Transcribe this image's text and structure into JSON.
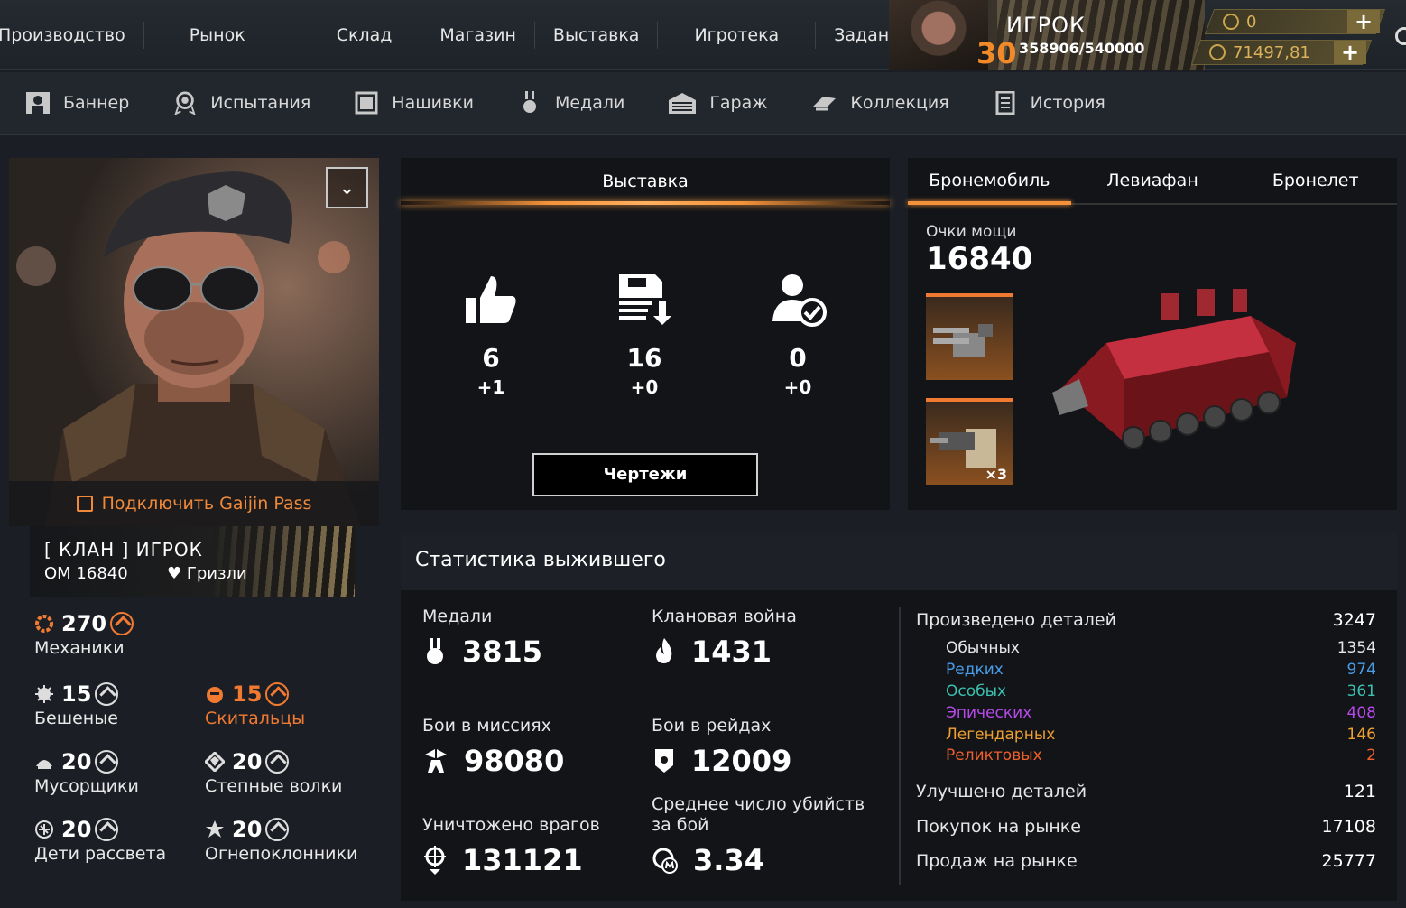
{
  "topnav": {
    "items": [
      "Производство",
      "Рынок",
      "Склад",
      "Магазин",
      "Выставка",
      "Игротека",
      "Задания"
    ]
  },
  "player": {
    "name": "ИГРОК",
    "level": "30",
    "xp": "358906/540000",
    "currency_1": "0",
    "currency_2": "71497,81"
  },
  "subnav": {
    "items": [
      {
        "label": "Баннер",
        "icon": "banner-icon"
      },
      {
        "label": "Испытания",
        "icon": "trials-icon"
      },
      {
        "label": "Нашивки",
        "icon": "patches-icon"
      },
      {
        "label": "Медали",
        "icon": "medals-icon"
      },
      {
        "label": "Гараж",
        "icon": "garage-icon"
      },
      {
        "label": "Коллекция",
        "icon": "collection-icon"
      },
      {
        "label": "История",
        "icon": "history-icon"
      }
    ]
  },
  "profile": {
    "gaijin_link": "Подключить Gaijin Pass",
    "clan_name": "[ КЛАН ]  ИГРОК",
    "om": "ОМ 16840",
    "faction_label": "Гризли",
    "factions": {
      "main": {
        "value": "270",
        "label": "Механики"
      },
      "list": [
        {
          "value": "15",
          "label": "Бешеные",
          "color": "#e8e8e8"
        },
        {
          "value": "15",
          "label": "Скитальцы",
          "color": "#f07a32"
        },
        {
          "value": "20",
          "label": "Мусорщики",
          "color": "#e8e8e8"
        },
        {
          "value": "20",
          "label": "Степные волки",
          "color": "#e8e8e8"
        },
        {
          "value": "20",
          "label": "Дети рассвета",
          "color": "#e8e8e8"
        },
        {
          "value": "20",
          "label": "Огнепоклонники",
          "color": "#e8e8e8"
        }
      ]
    }
  },
  "exhibition": {
    "title": "Выставка",
    "stats": [
      {
        "icon": "thumbs-up-icon",
        "value": "6",
        "delta": "+1"
      },
      {
        "icon": "download-icon",
        "value": "16",
        "delta": "+0"
      },
      {
        "icon": "subscriber-icon",
        "value": "0",
        "delta": "+0"
      }
    ],
    "button": "Чертежи"
  },
  "vehicle": {
    "tabs": [
      "Бронемобиль",
      "Левиафан",
      "Бронелет"
    ],
    "power_label": "Очки мощи",
    "power_value": "16840",
    "parts": [
      {
        "mult": ""
      },
      {
        "mult": "×3"
      }
    ]
  },
  "stats": {
    "title": "Статистика выжившего",
    "blocks": [
      {
        "label": "Медали",
        "value": "3815",
        "icon": "medal-icon"
      },
      {
        "label": "Клановая война",
        "value": "1431",
        "icon": "flame-icon"
      },
      {
        "label": "Бои в миссиях",
        "value": "98080",
        "icon": "missions-icon"
      },
      {
        "label": "Бои в рейдах",
        "value": "12009",
        "icon": "raid-icon"
      },
      {
        "label": "Уничтожено врагов",
        "value": "131121",
        "icon": "crosshair-icon"
      },
      {
        "label": "Среднее число убийств за бой",
        "value": "3.34",
        "icon": "avg-kills-icon"
      }
    ],
    "produced": {
      "label": "Произведено деталей",
      "value": "3247"
    },
    "rarities": [
      {
        "label": "Обычных",
        "value": "1354",
        "color": "#e6e6e6"
      },
      {
        "label": "Редких",
        "value": "974",
        "color": "#4a9ce8"
      },
      {
        "label": "Особых",
        "value": "361",
        "color": "#3cc0b0"
      },
      {
        "label": "Эпических",
        "value": "408",
        "color": "#b64ae8"
      },
      {
        "label": "Легендарных",
        "value": "146",
        "color": "#f0a030"
      },
      {
        "label": "Реликтовых",
        "value": "2",
        "color": "#f0602a"
      }
    ],
    "improved": {
      "label": "Улучшено деталей",
      "value": "121"
    },
    "bought": {
      "label": "Покупок на рынке",
      "value": "17108"
    },
    "sold": {
      "label": "Продаж на рынке",
      "value": "25777"
    }
  },
  "colors": {
    "accent": "#f3923a",
    "faction_orange": "#f07a32",
    "currency_gold": "#d9b25a"
  }
}
